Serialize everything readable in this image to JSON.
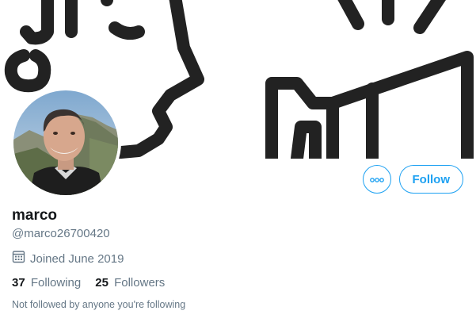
{
  "profile": {
    "name": "marco",
    "handle": "@marco26700420",
    "joined": "Joined June 2019",
    "following_count": "37",
    "following_label": "Following",
    "followers_count": "25",
    "followers_label": "Followers",
    "mutual_note": "Not followed by anyone you're following"
  },
  "actions": {
    "more_icon": "more-options-icon",
    "follow_label": "Follow"
  },
  "colors": {
    "accent": "#1da1f2",
    "banner_art": "#222222",
    "secondary_text": "#657786"
  }
}
